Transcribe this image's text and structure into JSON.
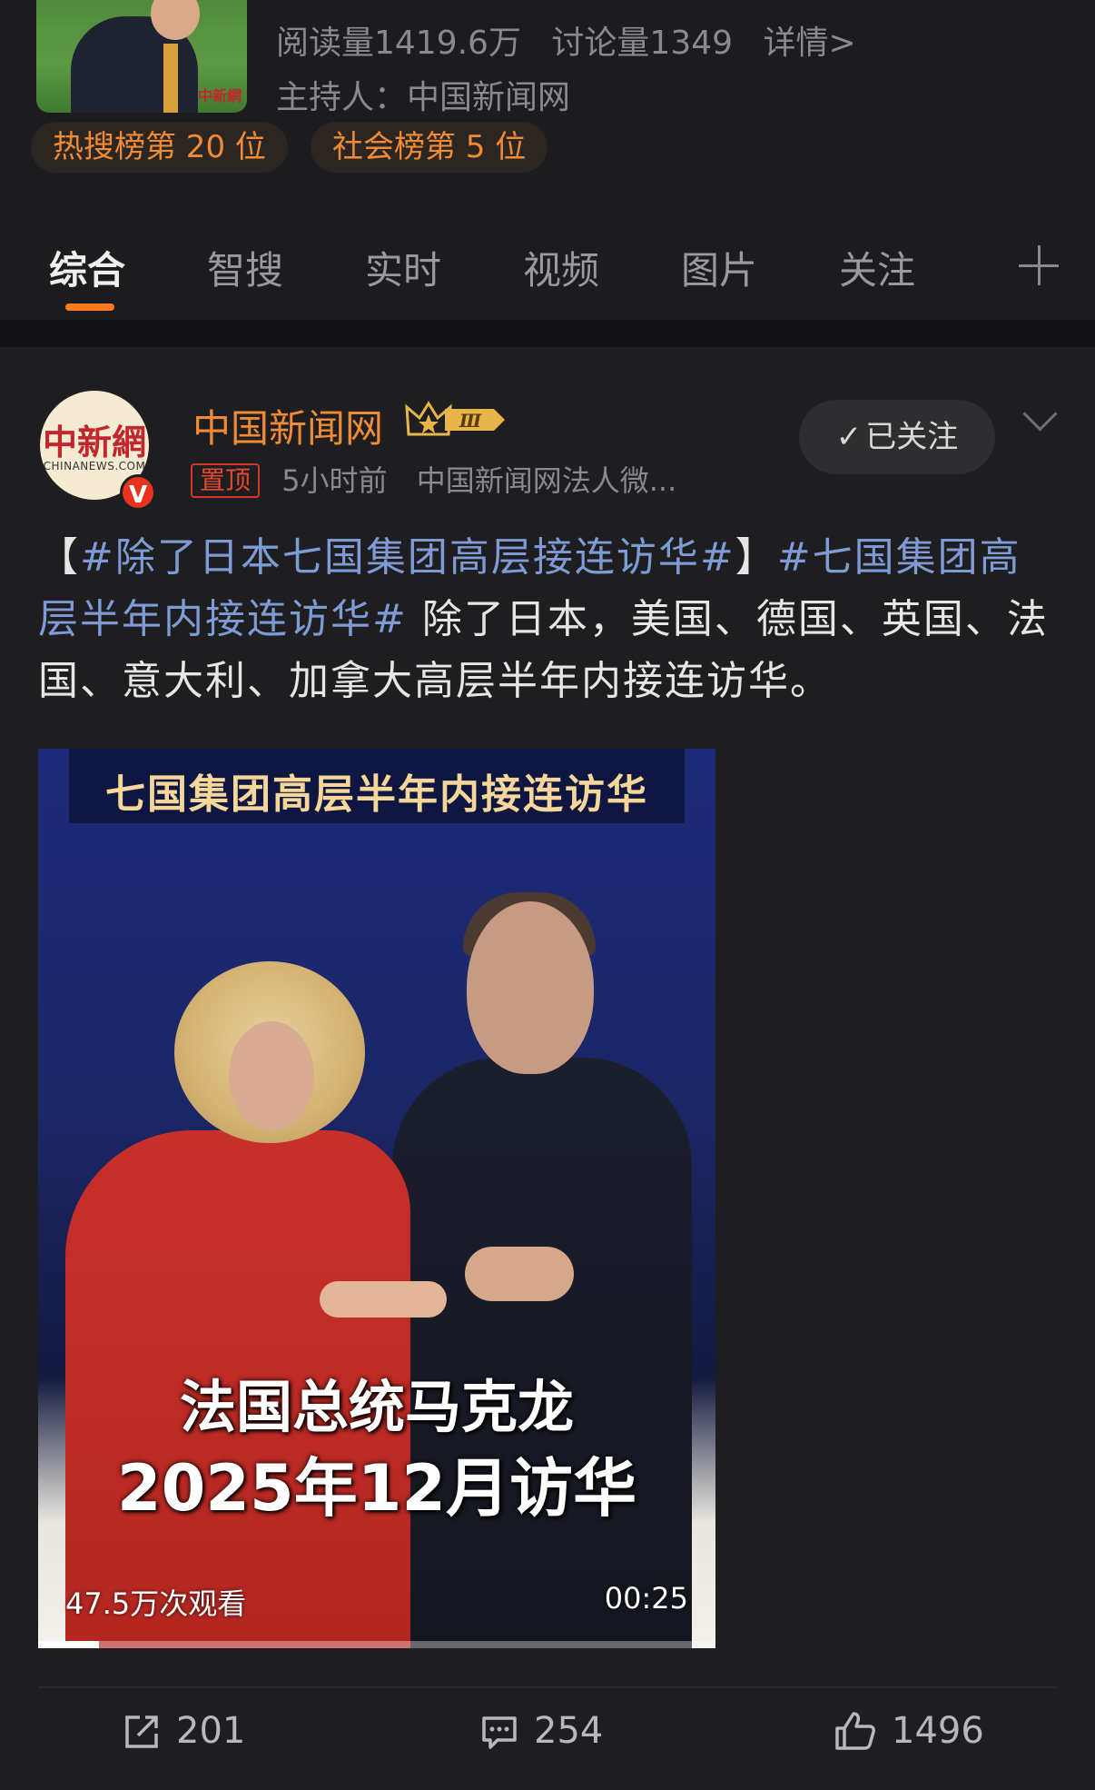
{
  "topic": {
    "stats": {
      "reads": "阅读量1419.6万",
      "discussions": "讨论量1349",
      "detail_link": "详情>"
    },
    "host": "主持人：中国新闻网",
    "thumb_watermark": "中新網",
    "ranks": [
      "热搜榜第 20 位",
      "社会榜第 5 位"
    ]
  },
  "tabs": {
    "items": [
      "综合",
      "智搜",
      "实时",
      "视频",
      "图片",
      "关注"
    ],
    "active_index": 0,
    "add_icon": "plus-icon"
  },
  "post": {
    "author": {
      "name": "中国新闻网",
      "avatar_logo_cn": "中新網",
      "avatar_logo_en": "CHINANEWS.COM",
      "verified_badge": "V",
      "member_badge": "Ⅲ",
      "pinned_label": "置顶",
      "time": "5小时前",
      "source": "中国新闻网法人微..."
    },
    "follow_button": "已关注",
    "text": {
      "bracket_open": "【",
      "hashtag1": "#除了日本七国集团高层接连访华#",
      "bracket_close": "】",
      "hashtag2": "#七国集团高层半年内接连访华#",
      "body": " 除了日本，美国、德国、英国、法国、意大利、加拿大高层半年内接连访华。"
    },
    "video": {
      "banner": "七国集团高层半年内接连访华",
      "caption_line1": "法国总统马克龙",
      "caption_line2": "2025年12月访华",
      "views": "47.5万次观看",
      "duration": "00:25",
      "progress": 0.09
    },
    "actions": {
      "reposts": "201",
      "comments": "254",
      "likes": "1496"
    }
  },
  "colors": {
    "accent_orange": "#ff7a1a",
    "author_orange": "#f08a34",
    "hashtag_blue": "#7f9bd6",
    "pin_red": "#e8482e",
    "background": "#1c1c1e"
  }
}
